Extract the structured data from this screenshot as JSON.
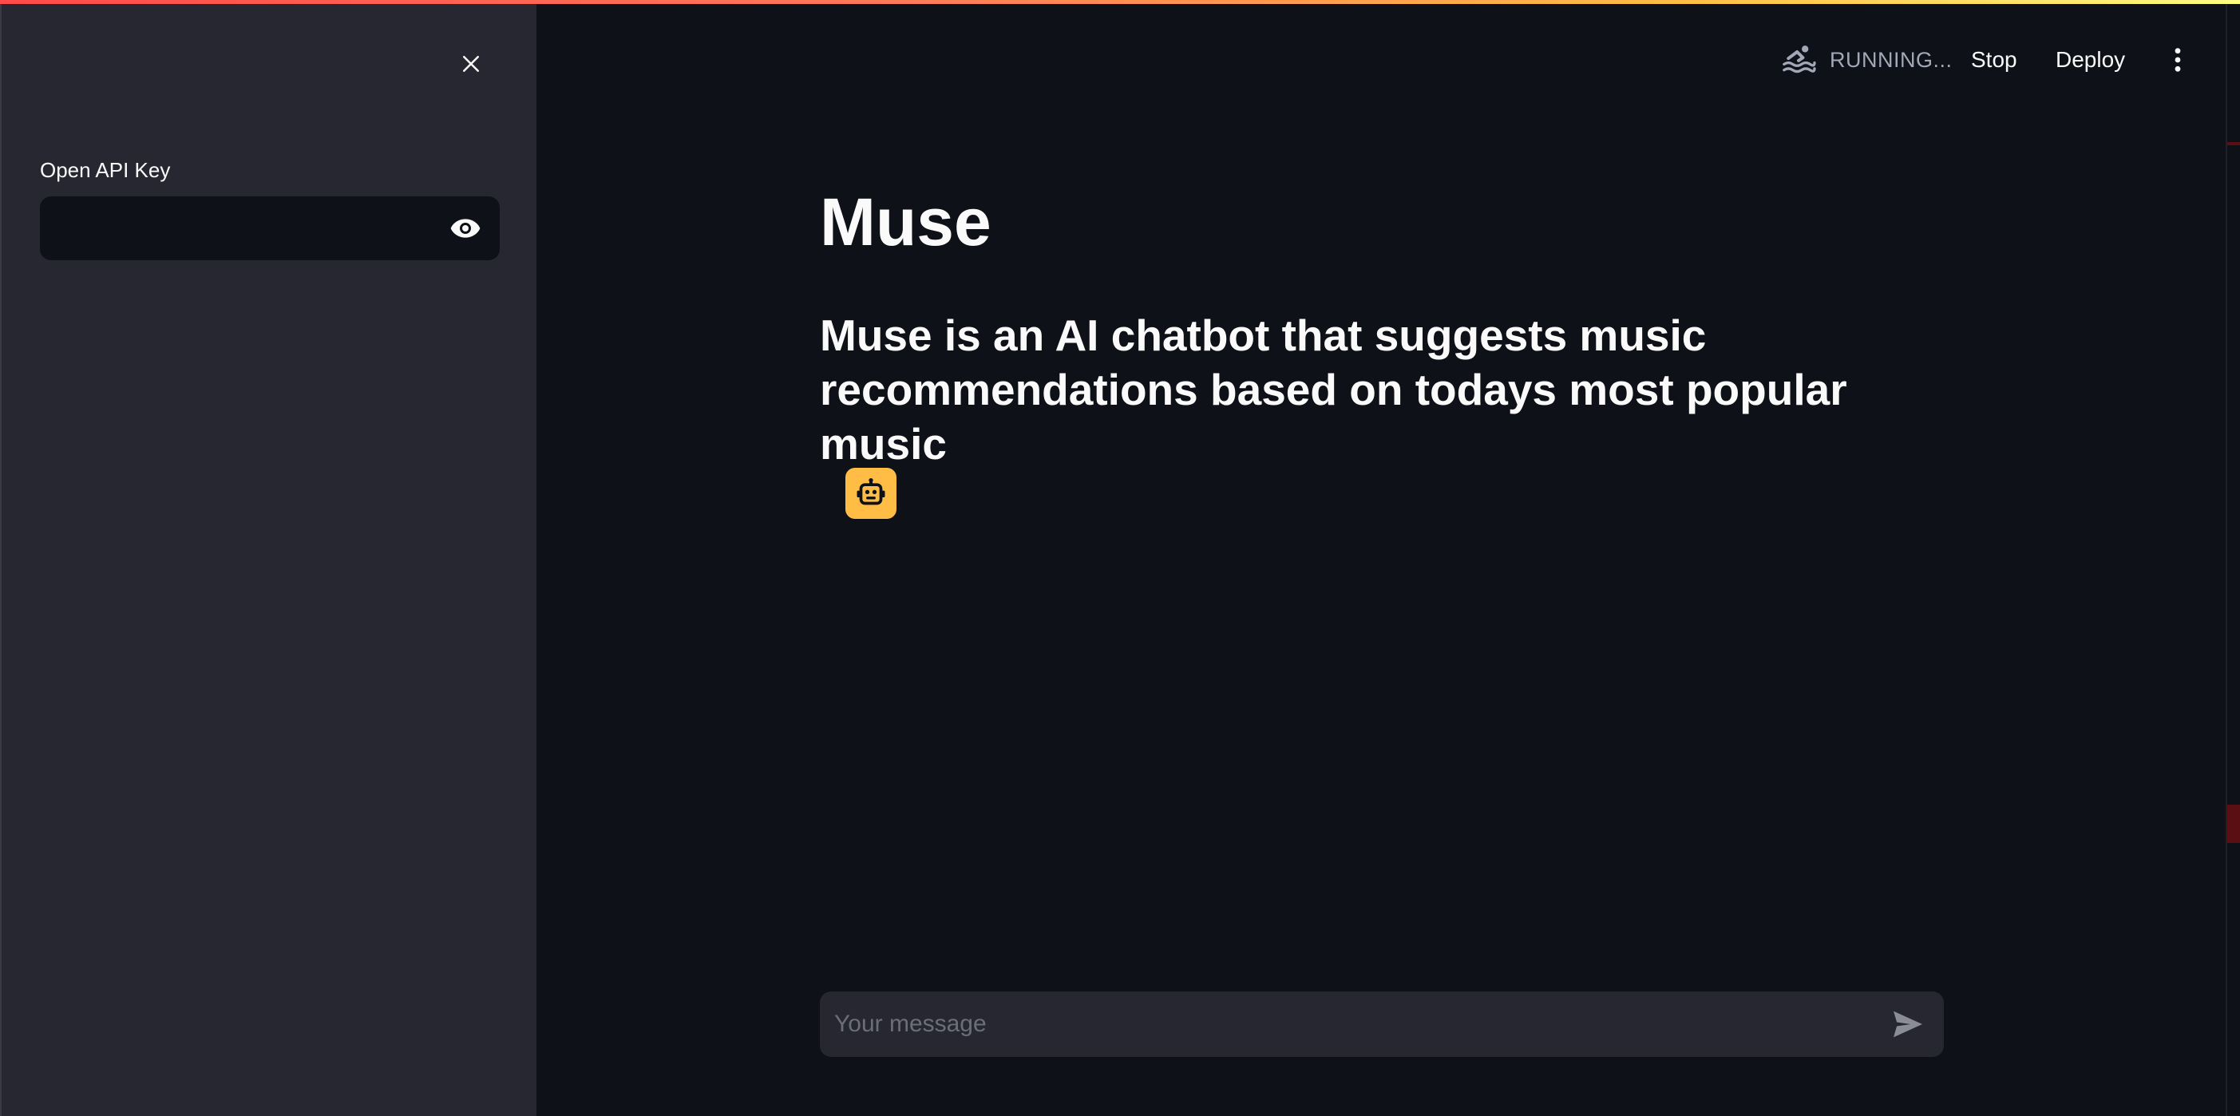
{
  "sidebar": {
    "api_key_label": "Open API Key",
    "api_key_value": "",
    "close_icon": "close-icon",
    "visibility_icon": "eye-icon"
  },
  "toolbar": {
    "status": "RUNNING...",
    "status_icon": "swimmer-icon",
    "stop_label": "Stop",
    "deploy_label": "Deploy",
    "menu_icon": "kebab-menu-icon"
  },
  "main": {
    "title": "Muse",
    "subtitle": "Muse is an AI chatbot that suggests music recommendations based on todays most popular music"
  },
  "chat": {
    "avatar_icon": "robot-icon",
    "input_placeholder": "Your message",
    "send_icon": "send-icon"
  },
  "colors": {
    "background": "#0e1117",
    "sidebar": "#262730",
    "accent": "#ffbd45",
    "top_gradient_start": "#ff4b4b",
    "top_gradient_end": "#fffd80"
  }
}
